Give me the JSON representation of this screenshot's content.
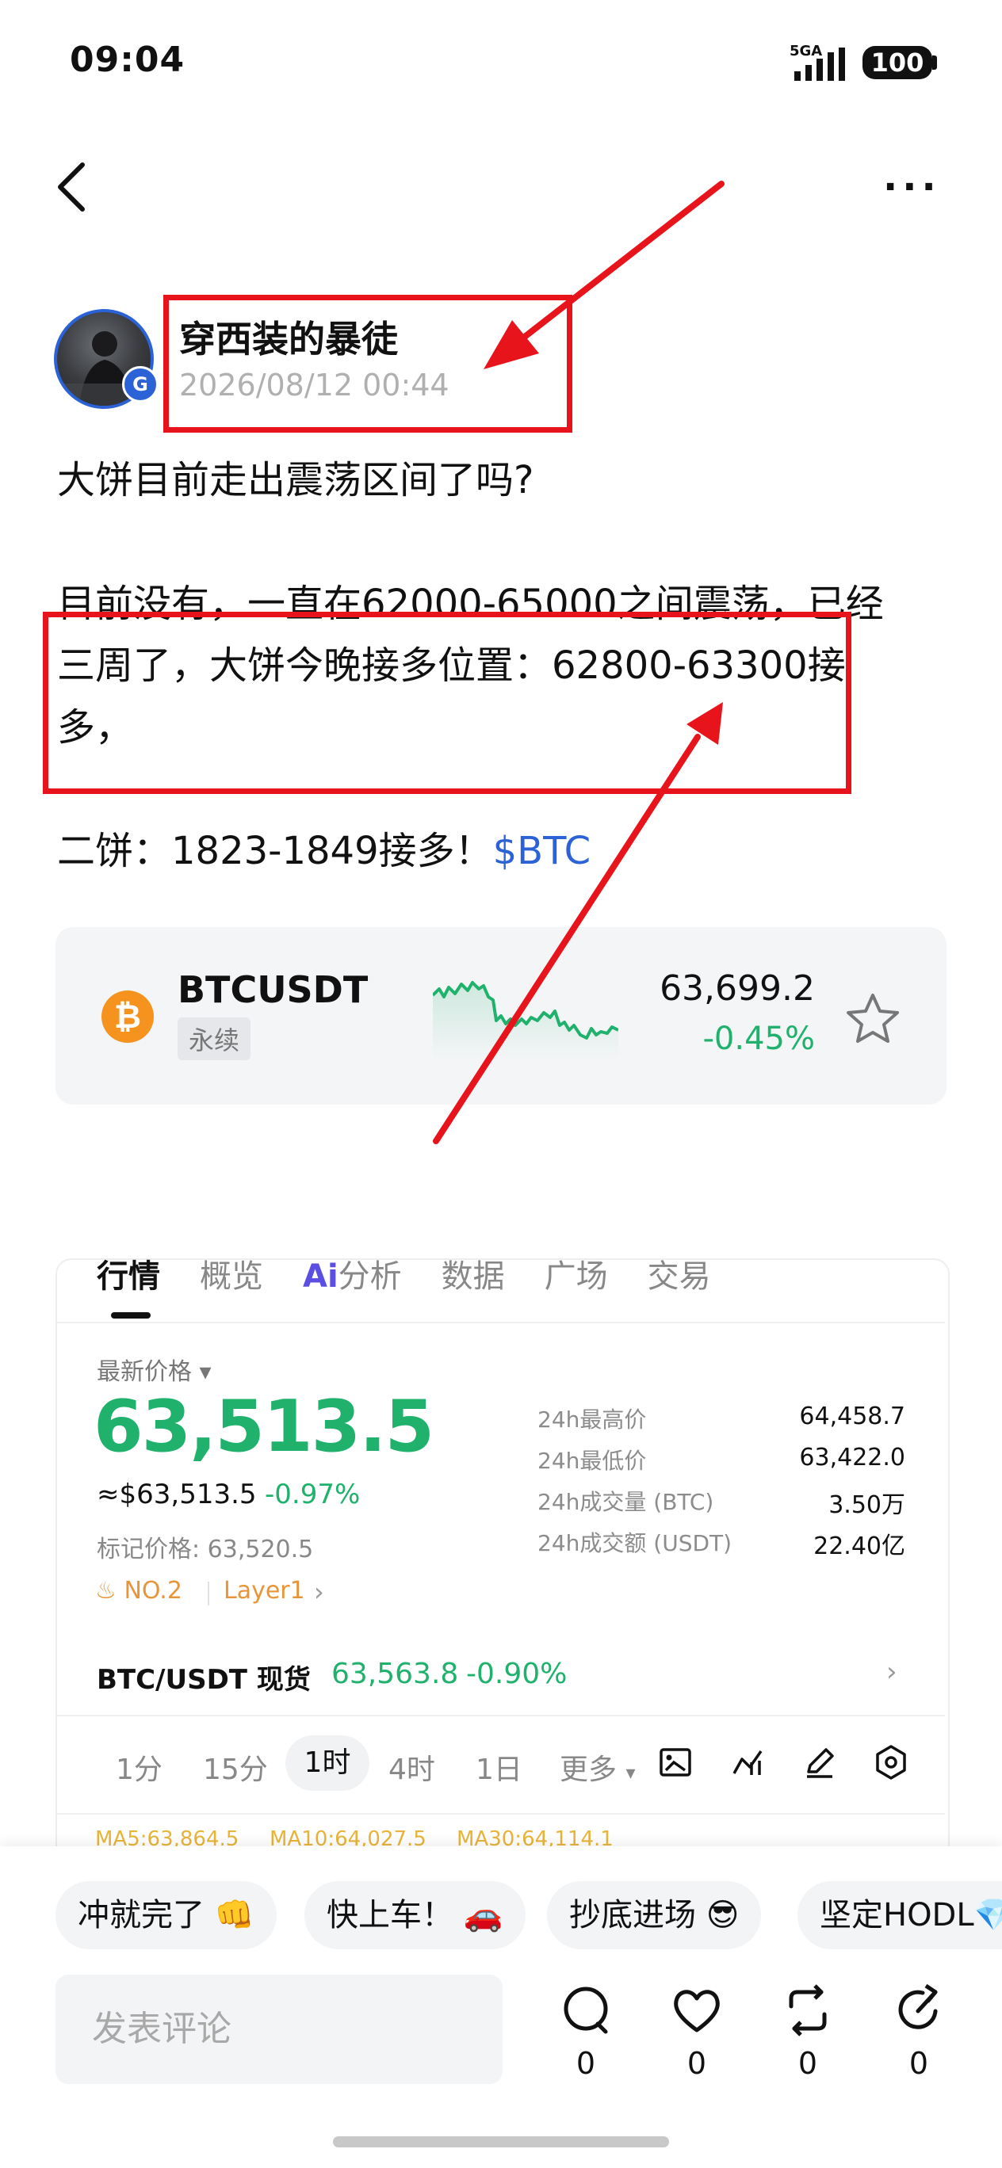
{
  "status_bar": {
    "time": "09:04",
    "network": "5GA",
    "battery": "100"
  },
  "post": {
    "author": "穿西装的暴徒",
    "datetime": "2026/08/12 00:44",
    "question": "大饼目前走出震荡区间了吗?",
    "body_line1": "目前没有，一直在62000-65000之间震荡，已经",
    "body_line2": "三周了，大饼今晚接多位置：62800-63300接",
    "body_line3": "多，",
    "body_line4_text": "二饼：1823-1849接多！",
    "ticker": "$BTC"
  },
  "market_card": {
    "symbol": "BTCUSDT",
    "type": "永续",
    "price": "63,699.2",
    "change": "-0.45%",
    "coin_icon": "bitcoin-icon",
    "accent_up": "#20b26c"
  },
  "panel": {
    "tabs": [
      "行情",
      "概览",
      "分析",
      "数据",
      "广场",
      "交易"
    ],
    "ai_prefix": "Ai",
    "latest_label": "最新价格",
    "last_price": "63,513.5",
    "usd_price": "≈$63,513.5",
    "usd_change": "-0.97%",
    "mark_price": "标记价格: 63,520.5",
    "rank_tag": "NO.2",
    "layer_tag": "Layer1",
    "stats": [
      {
        "label": "24h最高价",
        "value": "64,458.7"
      },
      {
        "label": "24h最低价",
        "value": "63,422.0"
      },
      {
        "label": "24h成交量 (BTC)",
        "value": "3.50万"
      },
      {
        "label": "24h成交额 (USDT)",
        "value": "22.40亿"
      }
    ],
    "spot_label": "BTC/USDT 现货",
    "spot_price": "63,563.8",
    "spot_change": "-0.90%",
    "timeframes": [
      "1分",
      "15分",
      "1时",
      "4时",
      "1日",
      "更多"
    ],
    "ma": [
      "MA5:63,864.5",
      "MA10:64,027.5",
      "MA30:64,114.1"
    ]
  },
  "bottom": {
    "chips": [
      "冲就完了 👊",
      "快上车！ 🚗",
      "抄底进场 😎",
      "坚定HODL💎"
    ],
    "comment_placeholder": "发表评论",
    "counts": [
      "0",
      "0",
      "0",
      "0"
    ]
  },
  "colors": {
    "annotation_red": "#e8141b",
    "link_blue": "#2b62d6",
    "green": "#20b26c"
  }
}
